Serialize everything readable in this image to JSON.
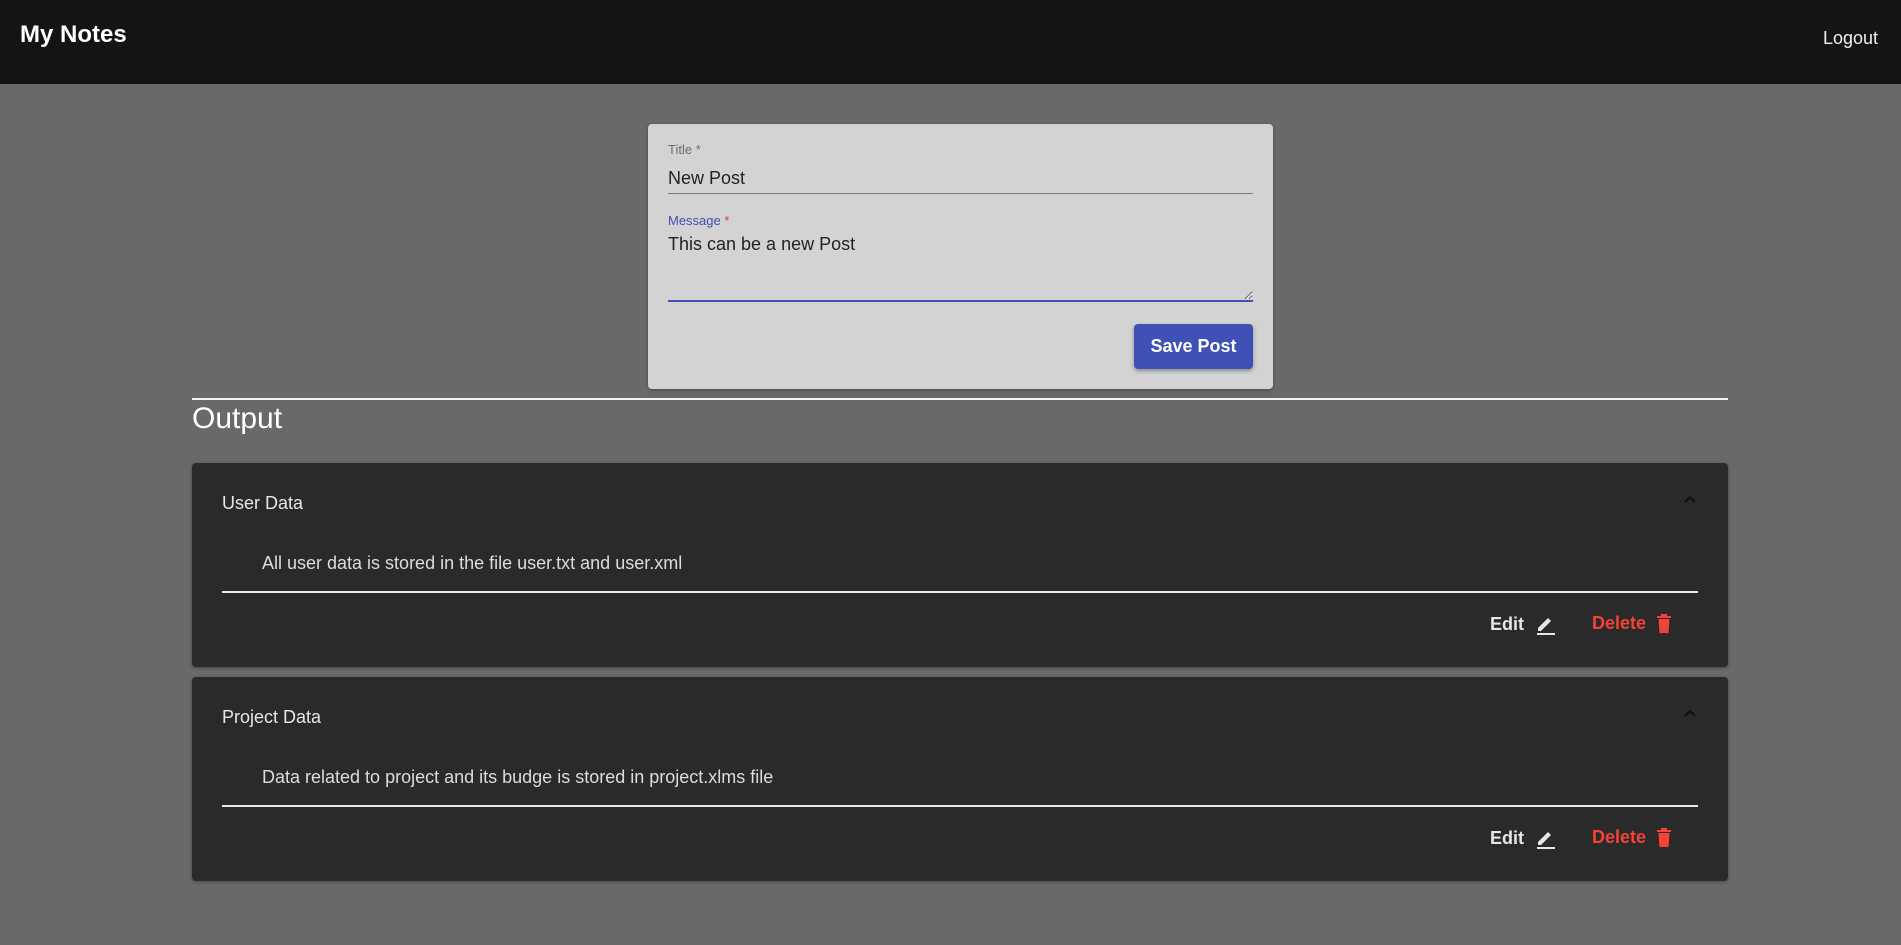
{
  "header": {
    "app_title": "My Notes",
    "logout_label": "Logout"
  },
  "form": {
    "title_label": "Title",
    "title_required": "*",
    "title_value": "New Post",
    "message_label": "Message",
    "message_required": "*",
    "message_value": "This can be a new Post",
    "save_label": "Save Post"
  },
  "output": {
    "heading": "Output",
    "notes": [
      {
        "title": "User Data",
        "body": "All user data is stored in the file user.txt and user.xml",
        "edit_label": "Edit",
        "delete_label": "Delete"
      },
      {
        "title": "Project Data",
        "body": "Data related to project and its budge is stored in project.xlms file",
        "edit_label": "Edit",
        "delete_label": "Delete"
      }
    ]
  },
  "colors": {
    "accent": "#3f51b5",
    "danger": "#f44336",
    "background": "#696969",
    "topbar": "#141414",
    "panel": "#2a2a2a"
  },
  "icons": {
    "edit": "pencil-icon",
    "delete": "trash-icon",
    "collapse": "chevron-up-icon"
  }
}
